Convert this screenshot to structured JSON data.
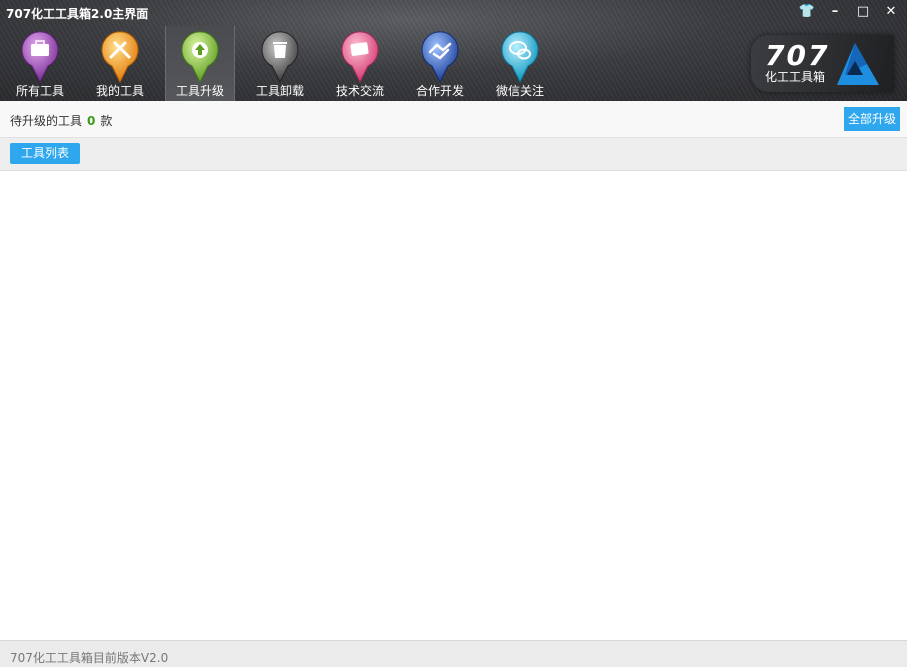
{
  "window": {
    "title": "707化工工具箱2.0主界面",
    "controls": {
      "skin": "👕",
      "minimize": "–",
      "maximize": "□",
      "close": "✕"
    }
  },
  "nav": {
    "items": [
      {
        "label": "所有工具",
        "icon": "briefcase-icon",
        "color": "#8b3fa6"
      },
      {
        "label": "我的工具",
        "icon": "tools-icon",
        "color": "#f0911a"
      },
      {
        "label": "工具升级",
        "icon": "upgrade-arrow-icon",
        "color": "#7cbf3a",
        "active": true
      },
      {
        "label": "工具卸载",
        "icon": "trash-icon",
        "color": "#555555"
      },
      {
        "label": "技术交流",
        "icon": "chat-cards-icon",
        "color": "#e35a8c"
      },
      {
        "label": "合作开发",
        "icon": "handshake-icon",
        "color": "#2b58b6"
      },
      {
        "label": "微信关注",
        "icon": "wechat-icon",
        "color": "#20b1d6"
      }
    ]
  },
  "logo": {
    "number": "707",
    "text": "化工工具箱"
  },
  "upgrade": {
    "pending_prefix": "待升级的工具",
    "count": "0",
    "pending_suffix": "款",
    "upgrade_all_label": "全部升级"
  },
  "tabs": {
    "tool_list_label": "工具列表"
  },
  "footer": {
    "version_text": "707化工工具箱目前版本V2.0"
  },
  "colors": {
    "accent": "#2ea7ee",
    "count_green": "#3a9b1a"
  }
}
